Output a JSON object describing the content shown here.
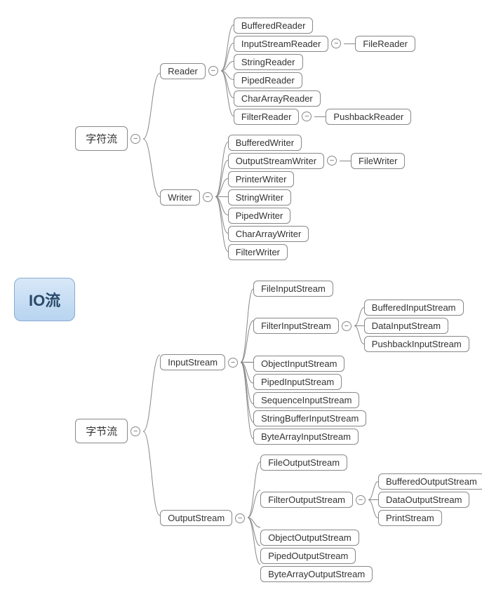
{
  "root": "IO流",
  "l1": {
    "char": "字符流",
    "byte": "字节流"
  },
  "reader": {
    "label": "Reader",
    "items": [
      "BufferedReader",
      "InputStreamReader",
      "StringReader",
      "PipedReader",
      "CharArrayReader",
      "FilterReader"
    ],
    "isr_child": "FileReader",
    "fr_child": "PushbackReader"
  },
  "writer": {
    "label": "Writer",
    "items": [
      "BufferedWriter",
      "OutputStreamWriter",
      "PrinterWriter",
      "StringWriter",
      "PipedWriter",
      "CharArrayWriter",
      "FilterWriter"
    ],
    "osw_child": "FileWriter"
  },
  "is": {
    "label": "InputStream",
    "items": [
      "FileInputStream",
      "FilterInputStream",
      "ObjectInputStream",
      "PipedInputStream",
      "SequenceInputStream",
      "StringBufferInputStream",
      "ByteArrayInputStream"
    ],
    "fis_children": [
      "BufferedInputStream",
      "DataInputStream",
      "PushbackInputStream"
    ]
  },
  "os": {
    "label": "OutputStream",
    "items": [
      "FileOutputStream",
      "FilterOutputStream",
      "ObjectOutputStream",
      "PipedOutputStream",
      "ByteArrayOutputStream"
    ],
    "fos_children": [
      "BufferedOutputStream",
      "DataOutputStream",
      "PrintStream"
    ]
  },
  "toggle": "−"
}
